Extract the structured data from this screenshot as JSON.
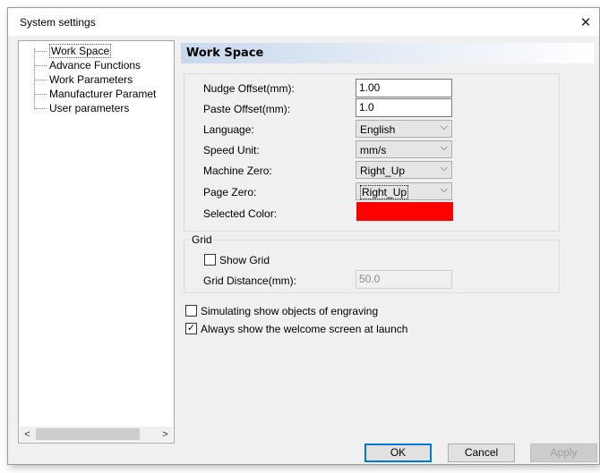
{
  "window": {
    "title": "System settings",
    "close_glyph": "✕"
  },
  "tree": {
    "items": [
      {
        "label": "Work Space",
        "selected": true
      },
      {
        "label": "Advance Functions"
      },
      {
        "label": "Work Parameters"
      },
      {
        "label": "Manufacturer Paramet"
      },
      {
        "label": "User parameters"
      }
    ],
    "scroll_left": "<",
    "scroll_right": ">"
  },
  "section": {
    "title": "Work Space"
  },
  "fields": {
    "nudge_offset": {
      "label": "Nudge Offset(mm):",
      "value": "1.00"
    },
    "paste_offset": {
      "label": "Paste Offset(mm):",
      "value": "1.0"
    },
    "language": {
      "label": "Language:",
      "value": "English"
    },
    "speed_unit": {
      "label": "Speed Unit:",
      "value": "mm/s"
    },
    "machine_zero": {
      "label": "Machine Zero:",
      "value": "Right_Up"
    },
    "page_zero": {
      "label": "Page Zero:",
      "value": "Right_Up"
    },
    "selected_color": {
      "label": "Selected Color:",
      "color": "#ff0000"
    }
  },
  "grid": {
    "legend": "Grid",
    "show_grid": {
      "label": "Show Grid",
      "checked": false
    },
    "distance": {
      "label": "Grid Distance(mm):",
      "value": "50.0"
    }
  },
  "options": {
    "simulating": {
      "label": "Simulating show objects of engraving",
      "checked": false
    },
    "welcome": {
      "label": "Always show the welcome screen at launch",
      "checked": true,
      "glyph": "✓"
    }
  },
  "buttons": {
    "ok": "OK",
    "cancel": "Cancel",
    "apply": "Apply"
  },
  "colors": {
    "header_gradient_start": "#c8d8ec",
    "default_button_border": "#0078d7"
  }
}
